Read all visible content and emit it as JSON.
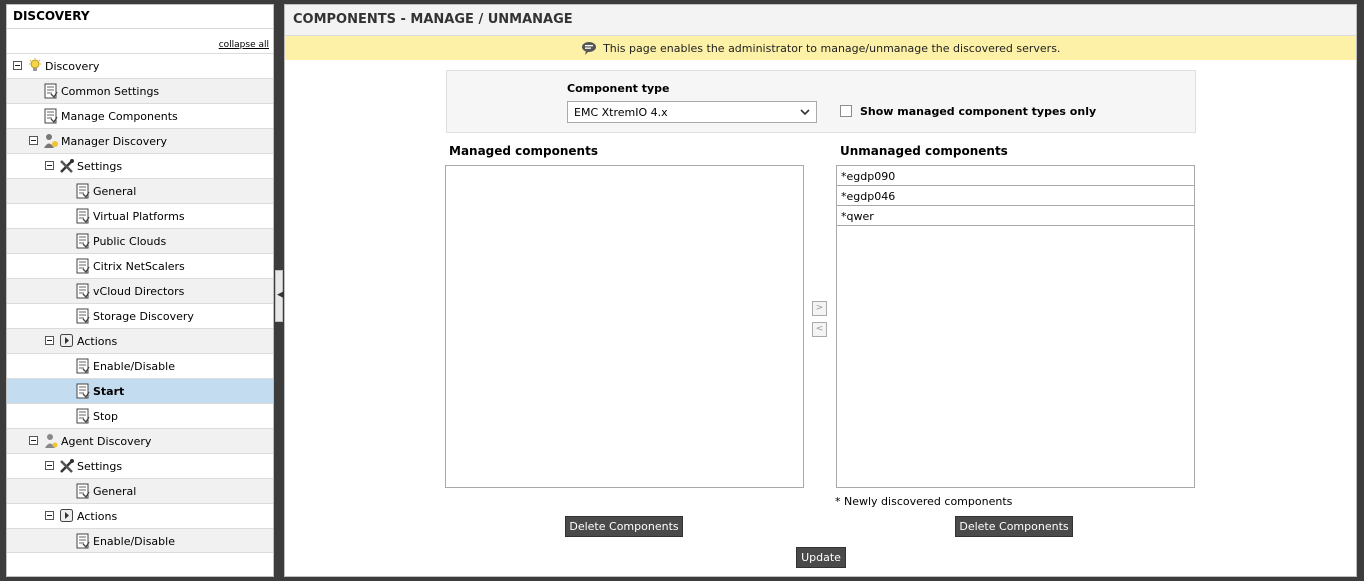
{
  "sidebar": {
    "title": "DISCOVERY",
    "collapse_all": "collapse all",
    "items": [
      {
        "label": "Discovery",
        "level": 0,
        "icon": "bulb-icon",
        "toggle": true
      },
      {
        "label": "Common Settings",
        "level": 1,
        "icon": "page-icon",
        "toggle": false
      },
      {
        "label": "Manage Components",
        "level": 1,
        "icon": "page-icon",
        "toggle": false
      },
      {
        "label": "Manager Discovery",
        "level": 1,
        "icon": "manager-icon",
        "toggle": true
      },
      {
        "label": "Settings",
        "level": 2,
        "icon": "tools-icon",
        "toggle": true
      },
      {
        "label": "General",
        "level": 3,
        "icon": "page-icon",
        "toggle": false
      },
      {
        "label": "Virtual Platforms",
        "level": 3,
        "icon": "page-icon",
        "toggle": false
      },
      {
        "label": "Public Clouds",
        "level": 3,
        "icon": "page-icon",
        "toggle": false
      },
      {
        "label": "Citrix NetScalers",
        "level": 3,
        "icon": "page-icon",
        "toggle": false
      },
      {
        "label": "vCloud Directors",
        "level": 3,
        "icon": "page-icon",
        "toggle": false
      },
      {
        "label": "Storage Discovery",
        "level": 3,
        "icon": "page-icon",
        "toggle": false
      },
      {
        "label": "Actions",
        "level": 2,
        "icon": "play-icon",
        "toggle": true
      },
      {
        "label": "Enable/Disable",
        "level": 3,
        "icon": "page-icon",
        "toggle": false
      },
      {
        "label": "Start",
        "level": 3,
        "icon": "page-icon",
        "toggle": false,
        "selected": true
      },
      {
        "label": "Stop",
        "level": 3,
        "icon": "page-icon",
        "toggle": false
      },
      {
        "label": "Agent Discovery",
        "level": 1,
        "icon": "agent-icon",
        "toggle": true
      },
      {
        "label": "Settings",
        "level": 2,
        "icon": "tools-icon",
        "toggle": true
      },
      {
        "label": "General",
        "level": 3,
        "icon": "page-icon",
        "toggle": false
      },
      {
        "label": "Actions",
        "level": 2,
        "icon": "play-icon",
        "toggle": true
      },
      {
        "label": "Enable/Disable",
        "level": 3,
        "icon": "page-icon",
        "toggle": false
      }
    ]
  },
  "main": {
    "title": "COMPONENTS - MANAGE / UNMANAGE",
    "info": "This page enables the administrator to manage/unmanage the discovered servers.",
    "component_type_label": "Component type",
    "component_type_value": "EMC XtremIO 4.x",
    "show_managed_label": "Show managed component types only",
    "show_managed_checked": false,
    "managed_title": "Managed components",
    "unmanaged_title": "Unmanaged components",
    "managed": [],
    "unmanaged": [
      "*egdp090",
      "*egdp046",
      "*qwer"
    ],
    "move_right": ">",
    "move_left": "<",
    "note": "* Newly discovered components",
    "delete_label": "Delete Components",
    "update_label": "Update"
  },
  "colors": {
    "selected_row": "#c4dcf0",
    "info_bar": "#fdf1a8",
    "dark_button": "#4a4a4a"
  }
}
